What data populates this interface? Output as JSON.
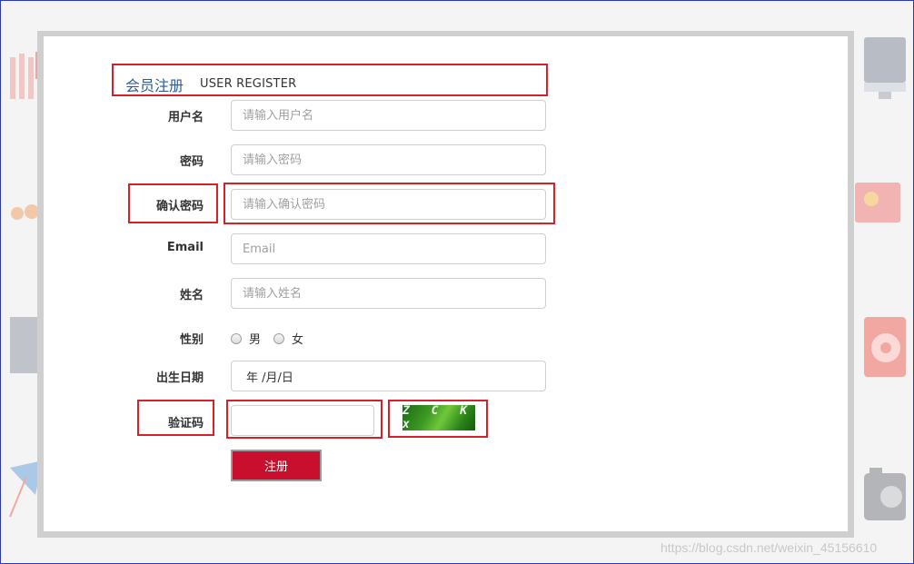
{
  "form": {
    "title_cn": "会员注册",
    "title_en": "USER REGISTER",
    "username": {
      "label": "用户名",
      "placeholder": "请输入用户名"
    },
    "password": {
      "label": "密码",
      "placeholder": "请输入密码"
    },
    "confirm_password": {
      "label": "确认密码",
      "placeholder": "请输入确认密码"
    },
    "email": {
      "label": "Email",
      "placeholder": "Email"
    },
    "name": {
      "label": "姓名",
      "placeholder": "请输入姓名"
    },
    "gender": {
      "label": "性别",
      "options": [
        "男",
        "女"
      ]
    },
    "birthday": {
      "label": "出生日期",
      "value": "年 /月/日"
    },
    "captcha": {
      "label": "验证码",
      "image_text": "Z C K x"
    },
    "submit_label": "注册"
  },
  "colors": {
    "highlight": "#d6202a",
    "title": "#2c5c9c",
    "button": "#c8102e"
  },
  "watermark": "https://blog.csdn.net/weixin_45156610"
}
